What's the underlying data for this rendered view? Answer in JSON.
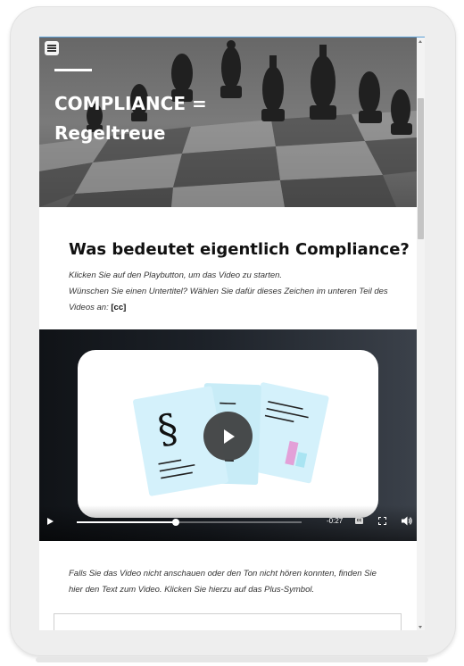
{
  "hero": {
    "title_line1": "COMPLIANCE =",
    "title_line2": "Regeltreue",
    "menu_icon": "hamburger-menu-icon"
  },
  "section": {
    "heading": "Was bedeutet eigentlich Compliance?",
    "line1": "Klicken Sie auf den Playbutton, um das Video zu starten.",
    "line2": "Wünschen Sie einen Untertitel? Wählen Sie dafür dieses Zeichen im unteren Teil des Videos an:",
    "cc_token": "[cc]"
  },
  "video": {
    "time_remaining": "-0:27",
    "progress": 0.44,
    "cc_label": "cc",
    "icons": [
      "play-icon",
      "closed-captions-icon",
      "fullscreen-icon",
      "volume-icon"
    ],
    "card_colors": {
      "doc": "#d4f1fb",
      "accent": "#e3a0d8",
      "play": "#3c3c3c"
    }
  },
  "followup": {
    "text": "Falls Sie das Video nicht anschauen oder den Ton nicht hören konnten, finden Sie hier den Text zum Video. Klicken Sie hierzu auf das Plus-Symbol."
  }
}
